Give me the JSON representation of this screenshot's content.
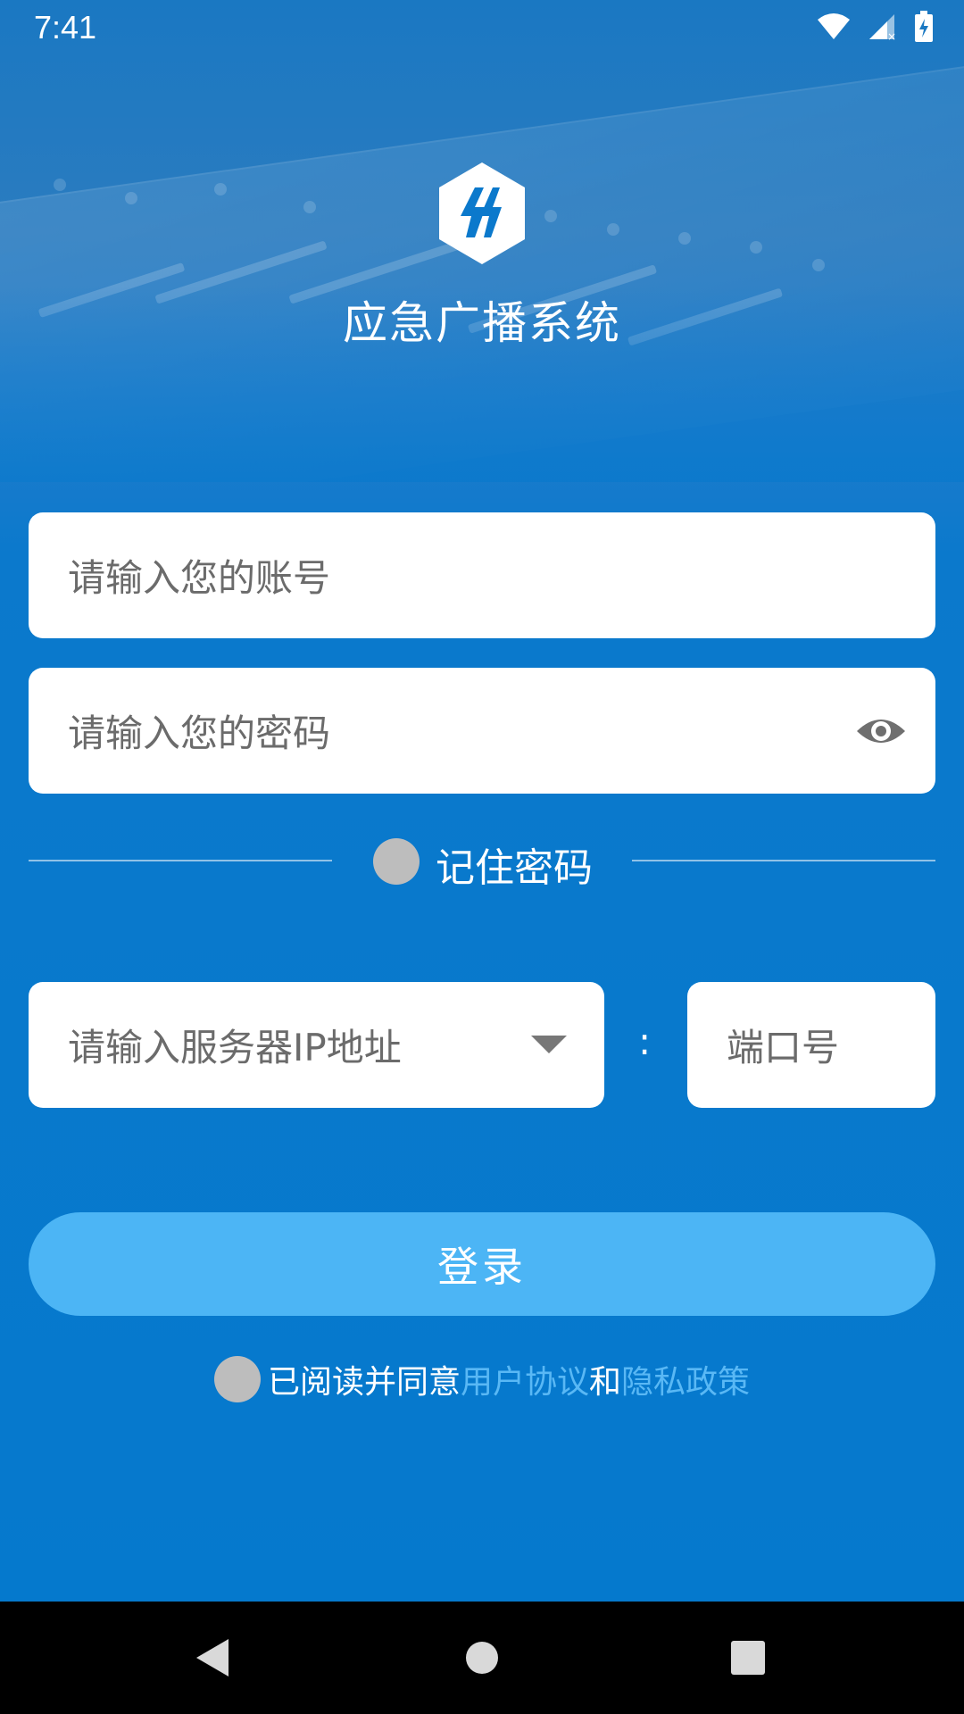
{
  "status_bar": {
    "time": "7:41"
  },
  "app": {
    "title": "应急广播系统"
  },
  "form": {
    "account_placeholder": "请输入您的账号",
    "password_placeholder": "请输入您的密码",
    "remember_label": "记住密码",
    "server_placeholder": "请输入服务器IP地址",
    "separator": ":",
    "port_placeholder": "端口号",
    "login_label": "登录"
  },
  "agreement": {
    "prefix": "已阅读并同意",
    "user_agreement": "用户协议",
    "and": "和",
    "privacy_policy": "隐私政策"
  },
  "icons": {
    "logo": "lightning-hexagon-icon",
    "wifi": "wifi-icon",
    "signal": "signal-icon",
    "battery": "battery-charging-icon",
    "eye": "eye-icon",
    "dropdown": "caret-down-icon",
    "back": "back-icon",
    "home": "home-icon",
    "recents": "recents-icon"
  },
  "colors": {
    "background": "#0B79CC",
    "login_button": "#4CB5F5",
    "link": "#59B8F5",
    "radio_off": "#BDBDBD"
  }
}
